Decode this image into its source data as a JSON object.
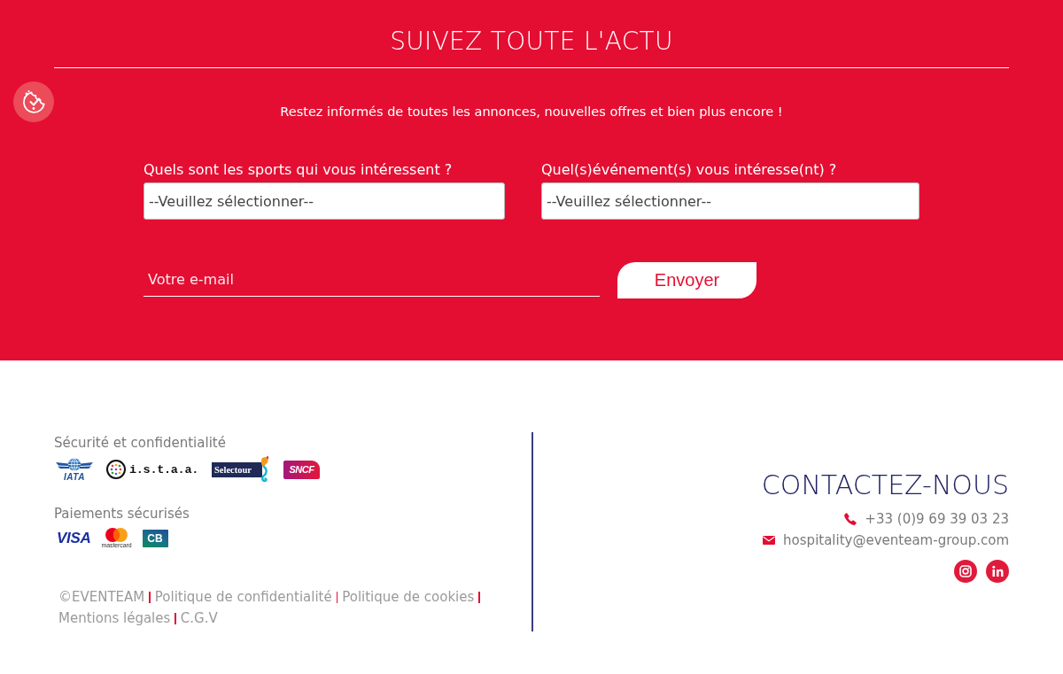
{
  "newsletter": {
    "title": "SUIVEZ TOUTE L'ACTU",
    "subtitle": "Restez informés de toutes les annonces, nouvelles offres et bien plus encore !",
    "selects": [
      {
        "label": "Quels sont les sports qui vous intéressent ?",
        "value": "--Veuillez sélectionner--"
      },
      {
        "label": "Quel(s)événement(s) vous intéresse(nt) ?",
        "value": "--Veuillez sélectionner--"
      }
    ],
    "email": {
      "placeholder": "Votre e-mail"
    },
    "submit": "Envoyer"
  },
  "footer": {
    "badge_groups": [
      {
        "heading": "Sécurité et confidentialité",
        "logos": [
          {
            "kind": "iata",
            "text": "IATA"
          },
          {
            "kind": "istaa",
            "text": "i.s.t.a.a."
          },
          {
            "kind": "selectour",
            "text": "Selectour"
          },
          {
            "kind": "sncf",
            "text": "SNCF"
          }
        ]
      },
      {
        "heading": "Paiements sécurisés",
        "logos": [
          {
            "kind": "visa",
            "text": "VISA"
          },
          {
            "kind": "mastercard",
            "text": "mastercard"
          },
          {
            "kind": "cb",
            "text": "CB"
          }
        ]
      }
    ],
    "links": [
      "©EVENTEAM",
      "Politique de confidentialité",
      "Politique de cookies",
      "Mentions légales",
      "C.G.V"
    ],
    "contact": {
      "title": "CONTACTEZ-NOUS",
      "items": [
        {
          "kind": "phone",
          "text": "+33 (0)9 69 39 03 23"
        },
        {
          "kind": "email",
          "text": "hospitality@eventeam-group.com"
        }
      ],
      "social": [
        {
          "kind": "instagram"
        },
        {
          "kind": "linkedin"
        }
      ]
    }
  }
}
